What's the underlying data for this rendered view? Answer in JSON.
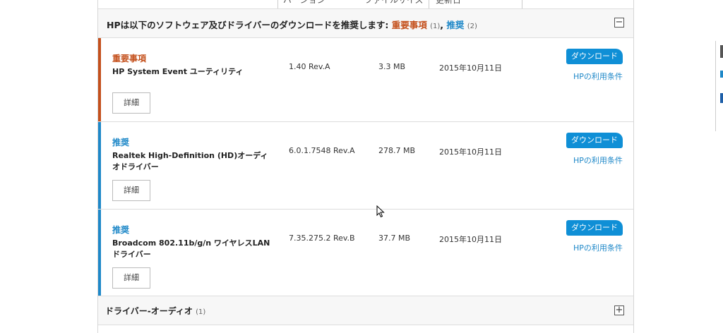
{
  "columns": [
    "バージョン",
    "ファイルサイズ",
    "更新日"
  ],
  "section": {
    "title_prefix": "HPは以下のソフトウェア及びドライバーのダウンロードを推奨します: ",
    "important_label": "重要事項",
    "important_count": "(1)",
    "comma": ", ",
    "recommended_label": "推奨",
    "recommended_count": "(2)",
    "collapse_symbol": "−"
  },
  "rows": [
    {
      "tag": "重要事項",
      "name": "HP System Event ユーティリティ",
      "version": "1.40 Rev.A",
      "size": "3.3 MB",
      "date": "2015年10月11日",
      "download": "ダウンロード",
      "terms": "HPの利用条件",
      "detail": "詳細",
      "bar_color": "#c4501c"
    },
    {
      "tag": "推奨",
      "name": "Realtek High-Definition (HD)オーディオドライバー",
      "version": "6.0.1.7548 Rev.A",
      "size": "278.7 MB",
      "date": "2015年10月11日",
      "download": "ダウンロード",
      "terms": "HPの利用条件",
      "detail": "詳細",
      "bar_color": "#1e88c8"
    },
    {
      "tag": "推奨",
      "name": "Broadcom 802.11b/g/n ワイヤレスLANドライバー",
      "version": "7.35.275.2 Rev.B",
      "size": "37.7 MB",
      "date": "2015年10月11日",
      "download": "ダウンロード",
      "terms": "HPの利用条件",
      "detail": "詳細",
      "bar_color": "#1e88c8"
    }
  ],
  "footer": {
    "title": "ドライバー-オーディオ",
    "count": "(1)",
    "expand_symbol": "+"
  }
}
